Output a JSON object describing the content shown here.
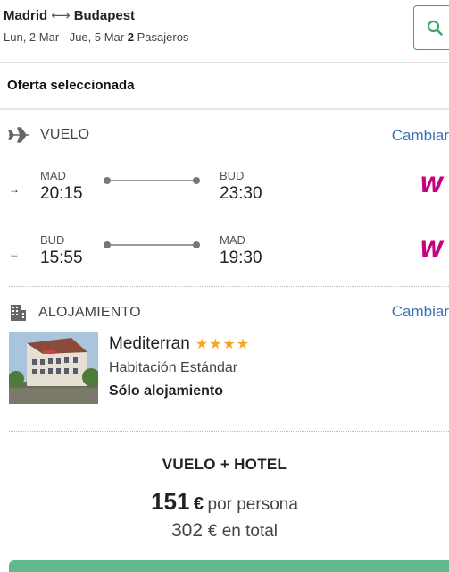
{
  "header": {
    "origin": "Madrid",
    "roundtrip_icon": "⟷",
    "destination": "Budapest",
    "dates": "Lun, 2 Mar - Jue, 5 Mar",
    "passengers_count": "2",
    "passengers_label": "Pasajeros",
    "search_icon": "search-icon",
    "accent": "#3aa86a"
  },
  "offer": {
    "title": "Oferta seleccionada"
  },
  "flight": {
    "label": "VUELO",
    "change": "Cambiar",
    "legs": [
      {
        "dir": "→",
        "from_code": "MAD",
        "from_time": "20:15",
        "to_code": "BUD",
        "to_time": "23:30",
        "airline": "W"
      },
      {
        "dir": "←",
        "from_code": "BUD",
        "from_time": "15:55",
        "to_code": "MAD",
        "to_time": "19:30",
        "airline": "W"
      }
    ]
  },
  "hotel": {
    "label": "ALOJAMIENTO",
    "change": "Cambiar",
    "name": "Mediterran",
    "stars": "★★★★",
    "star_count": 4,
    "room": "Habitación Estándar",
    "board": "Sólo alojamiento"
  },
  "price": {
    "package": "VUELO + HOTEL",
    "per_person_amount": "151",
    "currency": "€",
    "per_person_label": "por persona",
    "total_amount": "302",
    "total_label": "€ en total"
  },
  "colors": {
    "link": "#3d6fb6",
    "stars": "#f5a623",
    "airline": "#c6007e",
    "cta": "#5fb98a"
  }
}
